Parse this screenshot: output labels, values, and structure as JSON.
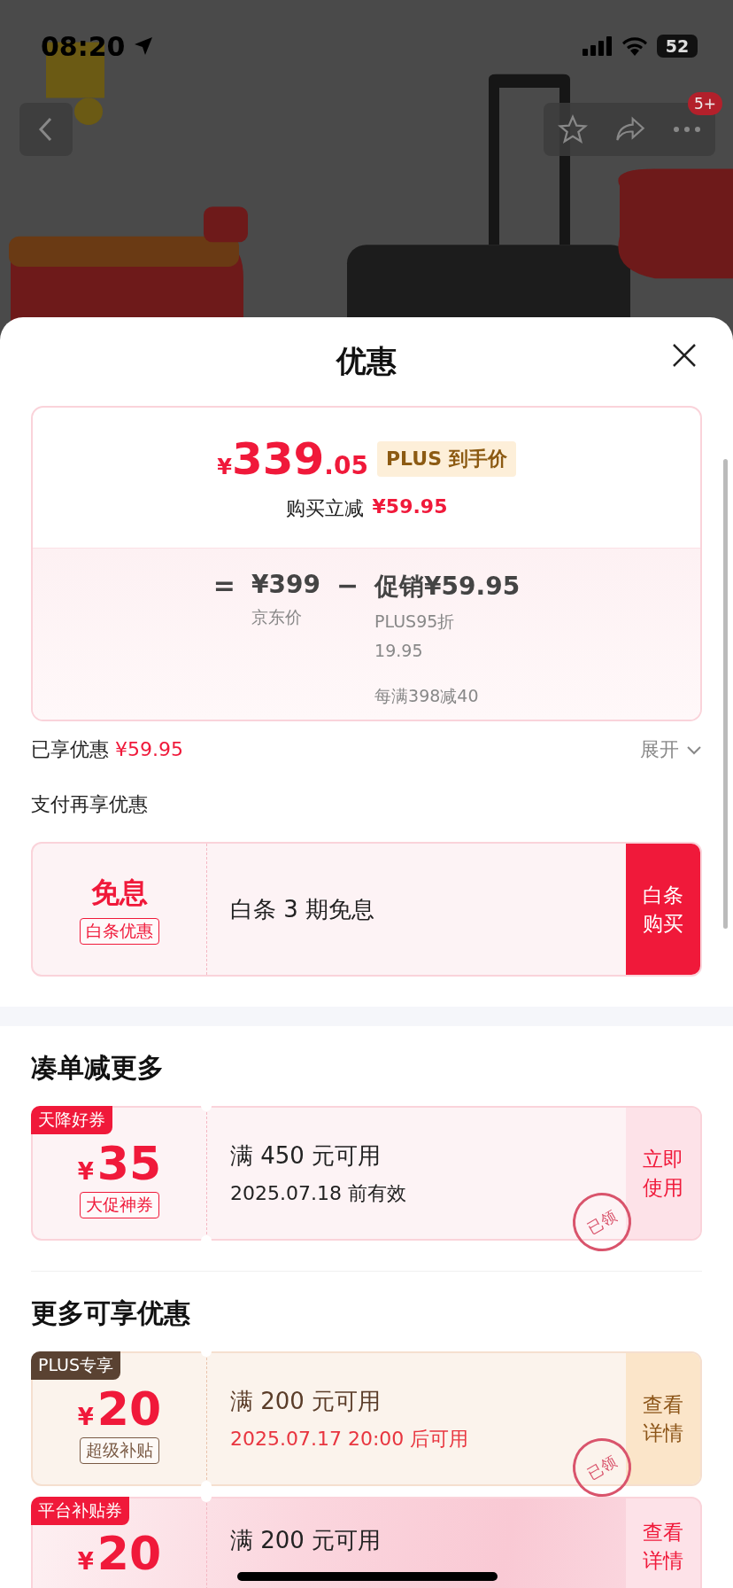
{
  "status_bar": {
    "time": "08:20",
    "battery": "52"
  },
  "nav": {
    "badge": "5+"
  },
  "sheet": {
    "title": "优惠",
    "price_card": {
      "currency": "¥",
      "integer": "339",
      "decimal": ".05",
      "tag": "PLUS 到手价",
      "saving_label": "购买立减",
      "saving_value": "¥59.95",
      "equals": "=",
      "base_price": "¥399",
      "base_label": "京东价",
      "minus": "−",
      "promo": "促销¥59.95",
      "promo_lines": [
        "PLUS95折",
        "19.95"
      ],
      "promo_rule": "每满398减40"
    },
    "enjoyed": {
      "label": "已享优惠",
      "value": "¥59.95",
      "toggle": "展开",
      "expanded": false
    },
    "pay_title": "支付再享优惠",
    "pay_card": {
      "headline": "免息",
      "tag": "白条优惠",
      "description": "白条 3 期免息",
      "button": "白条购买"
    },
    "sections": [
      {
        "title": "凑单减更多",
        "coupons": [
          {
            "kind": "promo",
            "corner": "天降好券",
            "currency": "¥",
            "amount": "35",
            "tag": "大促神券",
            "title": "满 450 元可用",
            "subtitle": "2025.07.18 前有效",
            "subtitle_highlight": false,
            "stamp": "已领",
            "button": "立即使用"
          }
        ]
      },
      {
        "title": "更多可享优惠",
        "coupons": [
          {
            "kind": "plus",
            "corner": "PLUS专享",
            "currency": "¥",
            "amount": "20",
            "tag": "超级补贴",
            "title": "满 200 元可用",
            "subtitle": "2025.07.17 20:00 后可用",
            "subtitle_highlight": true,
            "stamp": "已领",
            "button": "查看详情"
          },
          {
            "kind": "platform",
            "corner": "平台补贴券",
            "currency": "¥",
            "amount": "20",
            "title": "满 200 元可用",
            "button": "查看详情"
          }
        ]
      }
    ]
  }
}
